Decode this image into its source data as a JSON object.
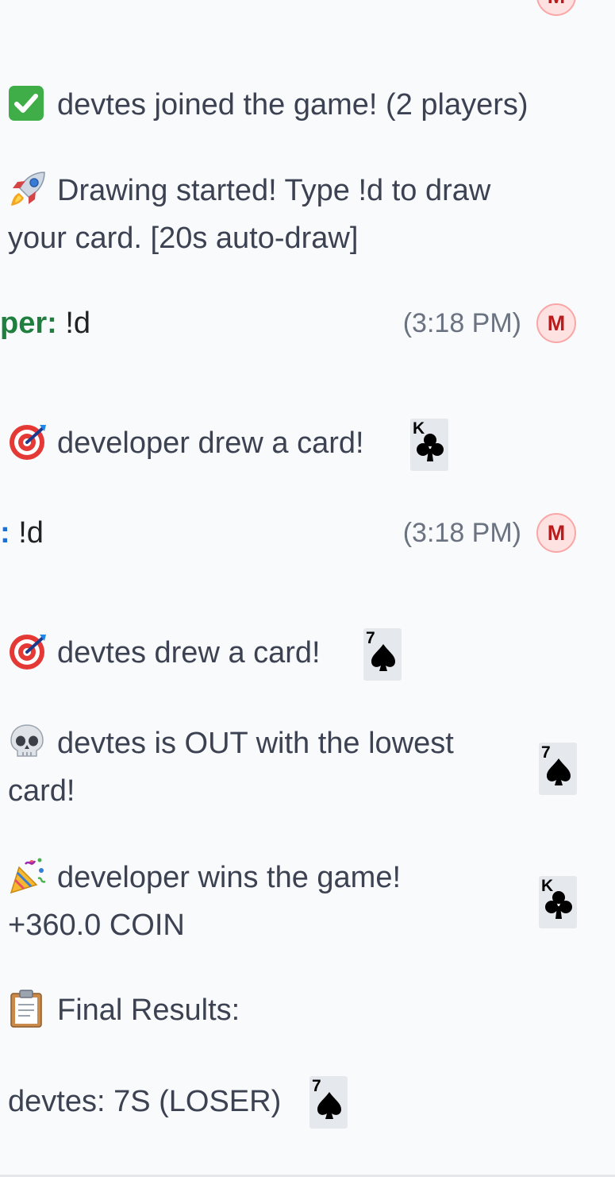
{
  "top_partial": {
    "avatar_letter": "M"
  },
  "messages": [
    {
      "emoji": "check-icon",
      "text": "devtes joined the game! (2 players)"
    },
    {
      "emoji": "rocket-icon",
      "line1": "Drawing started! Type !d to draw",
      "line2": "your card. [20s auto-draw]"
    }
  ],
  "user_msg_1": {
    "name": "per:",
    "text": "!d",
    "time": "(3:18 PM)",
    "avatar_letter": "M"
  },
  "draw_1": {
    "emoji": "target-icon",
    "text": "developer drew a card!",
    "card_rank": "K",
    "card_suit": "clubs"
  },
  "user_msg_2": {
    "name": ":",
    "text": "!d",
    "time": "(3:18 PM)",
    "avatar_letter": "M"
  },
  "draw_2": {
    "emoji": "target-icon",
    "text": "devtes drew a card!",
    "card_rank": "7",
    "card_suit": "spades"
  },
  "out": {
    "emoji": "skull-icon",
    "line1": "devtes is OUT with the lowest",
    "line2": "card!",
    "card_rank": "7",
    "card_suit": "spades"
  },
  "win": {
    "emoji": "party-icon",
    "line1": "developer wins the game!",
    "line2": "+360.0 COIN",
    "card_rank": "K",
    "card_suit": "clubs"
  },
  "results": {
    "emoji": "clipboard-icon",
    "text": "Final Results:"
  },
  "result_row": {
    "text": "devtes: 7S (LOSER)",
    "card_rank": "7",
    "card_suit": "spades"
  },
  "colors": {
    "name_green": "#1e7f3e",
    "name_blue": "#1f6fd0",
    "avatar_bg": "#fee2e2",
    "avatar_text": "#b91c1c",
    "card_bg": "#e5e9ee"
  }
}
